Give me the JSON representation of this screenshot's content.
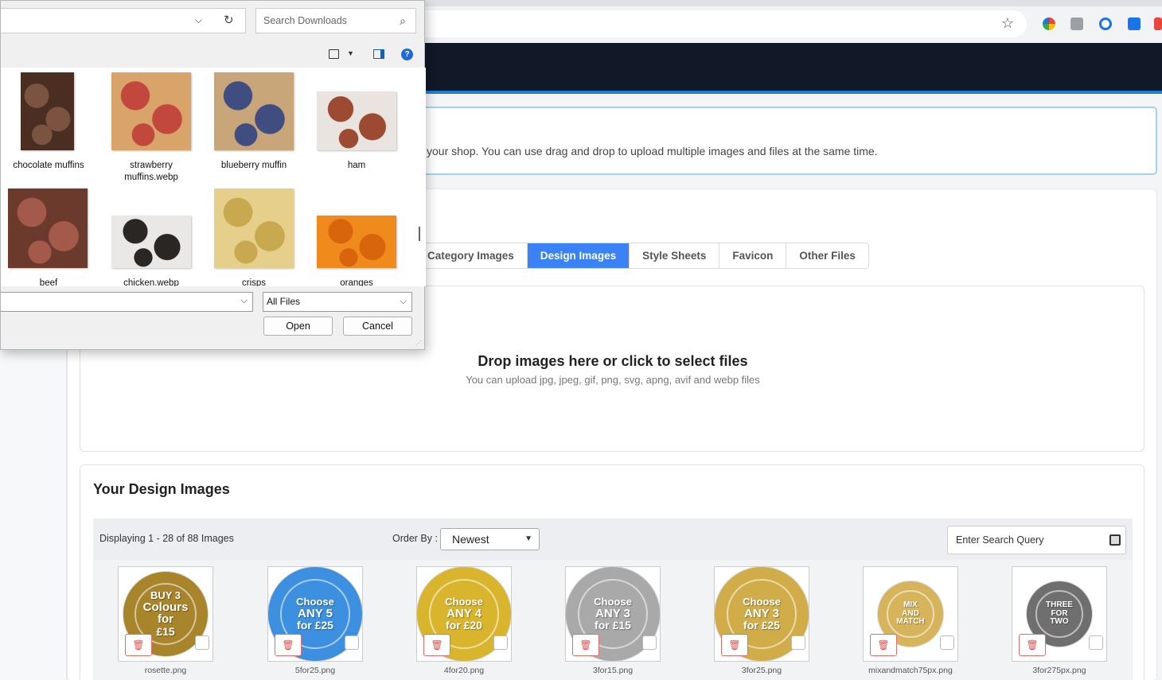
{
  "browser": {
    "extension_colors": [
      "#e8453c",
      "#9aa0a6",
      "#1a73e8",
      "#1a73e8"
    ]
  },
  "info": {
    "text": "your shop. You can use drag and drop to upload multiple images and files at the same time."
  },
  "tabs": [
    {
      "label": "Category Images",
      "active": false
    },
    {
      "label": "Design Images",
      "active": true
    },
    {
      "label": "Style Sheets",
      "active": false
    },
    {
      "label": "Favicon",
      "active": false
    },
    {
      "label": "Other Files",
      "active": false
    }
  ],
  "dropzone": {
    "title": "Drop images here or click to select files",
    "subtitle": "You can upload jpg, jpeg, gif, png, svg, apng, avif and webp files"
  },
  "images_section": {
    "title": "Your Design Images",
    "display_count": "Displaying 1 - 28 of 88 Images",
    "order_label": "Order By :",
    "order_value": "Newest",
    "search_placeholder": "Enter Search Query",
    "items": [
      {
        "name": "rosette.png",
        "color": "#a8842a",
        "lines": [
          "BUY 3",
          "Colours for",
          "£15"
        ]
      },
      {
        "name": "5for25.png",
        "color": "#3d8fe0",
        "lines": [
          "Choose",
          "ANY 5",
          "for £25"
        ]
      },
      {
        "name": "4for20.png",
        "color": "#d9b52e",
        "lines": [
          "Choose",
          "ANY 4",
          "for £20"
        ]
      },
      {
        "name": "3for15.png",
        "color": "#a9a9a9",
        "lines": [
          "Choose",
          "ANY 3",
          "for £15"
        ]
      },
      {
        "name": "3for25.png",
        "color": "#d1ad4a",
        "lines": [
          "Choose",
          "ANY 3",
          "for £25"
        ]
      },
      {
        "name": "mixandmatch75px.png",
        "color": "#d6b45c",
        "lines": [
          "MIX",
          "AND",
          "MATCH"
        ]
      },
      {
        "name": "3for275px.png",
        "color": "#6f6f6f",
        "lines": [
          "THREE",
          "FOR",
          "TWO"
        ]
      }
    ]
  },
  "dialog": {
    "search_placeholder": "Search Downloads",
    "file_type": "All Files",
    "open_label": "Open",
    "cancel_label": "Cancel",
    "files": [
      {
        "label": "chocolate muffins",
        "colors": [
          "#4a2e22",
          "#7a5441"
        ]
      },
      {
        "label": "strawberry muffins.webp",
        "colors": [
          "#d9a46a",
          "#c2483e"
        ]
      },
      {
        "label": "blueberry muffin",
        "colors": [
          "#c9a57a",
          "#3f4d80"
        ]
      },
      {
        "label": "ham",
        "colors": [
          "#e9e4df",
          "#9c4a32"
        ]
      },
      {
        "label": "beef",
        "colors": [
          "#6b3a2c",
          "#a45a4a"
        ]
      },
      {
        "label": "chicken.webp",
        "colors": [
          "#eae8e6",
          "#2a2624"
        ]
      },
      {
        "label": "crisps",
        "colors": [
          "#e6cf8a",
          "#c9a94f"
        ]
      },
      {
        "label": "oranges",
        "colors": [
          "#f08a1c",
          "#d8650c"
        ]
      }
    ]
  }
}
